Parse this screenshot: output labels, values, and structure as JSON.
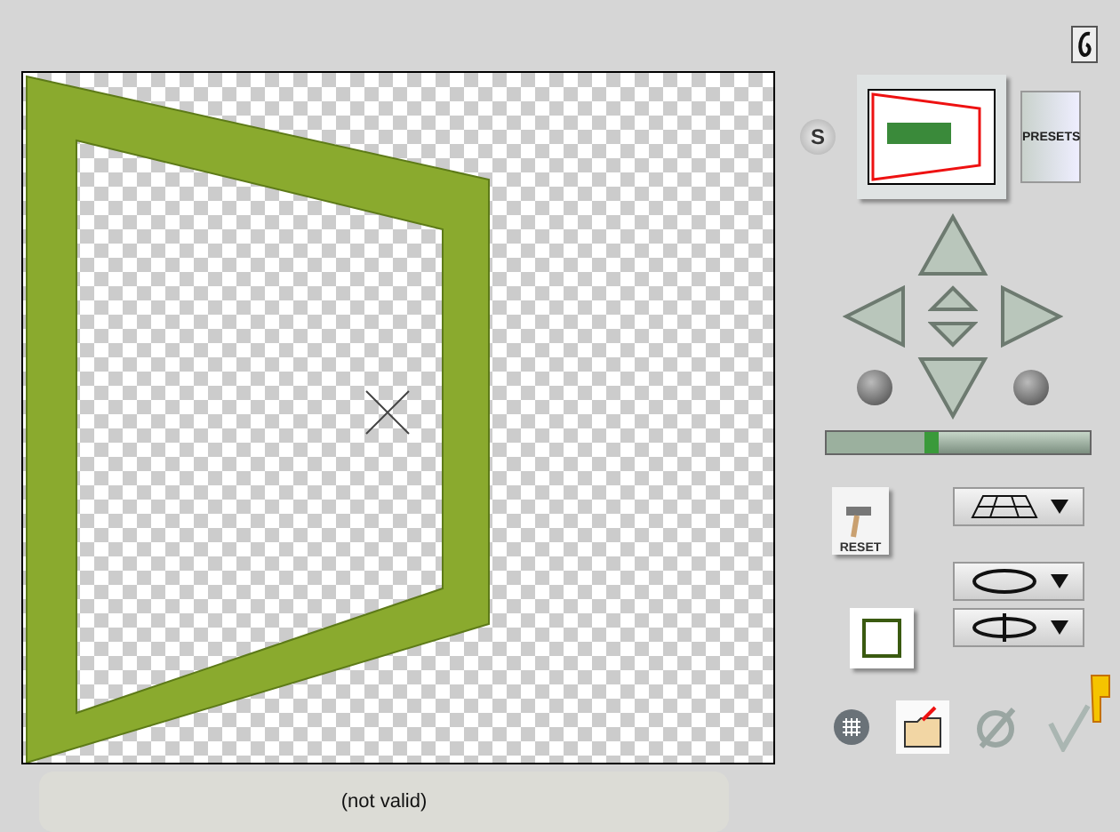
{
  "preview": {
    "show_button": "S",
    "presets_button": "PRESETS"
  },
  "zoom_slider": {
    "level": 0.4
  },
  "tools": {
    "reset_button": "RESET"
  },
  "status_bar": {
    "text": "(not valid)"
  }
}
